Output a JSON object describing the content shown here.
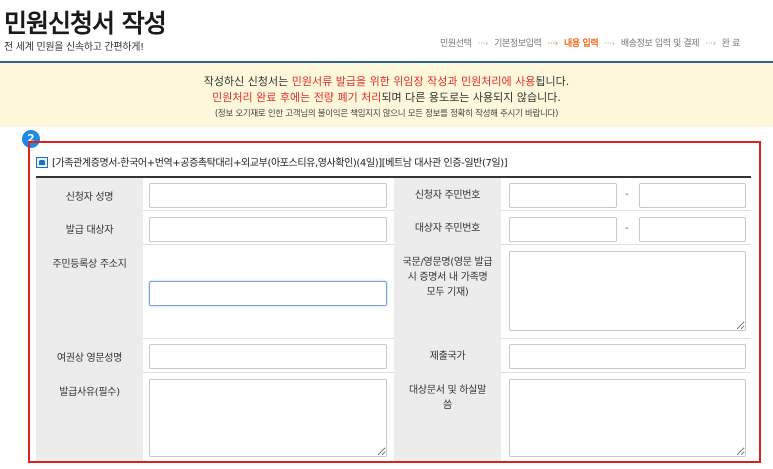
{
  "header": {
    "title": "민원신청서 작성",
    "subtitle": "전 세계 민원을 신속하고 간편하게!"
  },
  "steps": [
    {
      "label": "민원선택",
      "active": false
    },
    {
      "label": "기본정보입력",
      "active": false
    },
    {
      "label": "내용 입력",
      "active": true
    },
    {
      "label": "배송정보 입력 및 결제",
      "active": false
    },
    {
      "label": "완 료",
      "active": false
    }
  ],
  "notice": {
    "line1_a": "작성하신 신청서는 ",
    "line1_b": "민원서류 발급을 위한 위임장 작성과 민원처리에 사용",
    "line1_c": "됩니다.",
    "line2_a": "민원처리 완료 후에는 전량 폐기 처리",
    "line2_b": "되며 다른 용도로는 사용되지 않습니다.",
    "line3": "(정보 오기재로 인한 고객님의 불이익은 책임지지 않으니 모든 정보를 정확히 작성해 주시기 바랍니다)"
  },
  "section": {
    "badge": "2",
    "product_title": "[가족관계증명서-한국어+번역+공증촉탁대리+외교부(아포스티유,영사확인)(4일)][베트남 대사관 인증-일반(7일)]"
  },
  "form": {
    "applicant_name_label": "신청자 성명",
    "applicant_rrn_label": "신청자 주민번호",
    "target_label": "발급 대상자",
    "target_rrn_label": "대상자 주민번호",
    "address_label": "주민등록상 주소지",
    "name_local_label": "국문/영문명(영문 발급 시 증명서 내 가족명 모두 기재)",
    "passport_name_label": "여권상 영문성명",
    "country_label": "제출국가",
    "reason_label": "발급사유(필수)",
    "target_docs_label": "대상문서 및 하실말씀",
    "rrn_separator": "-"
  },
  "colors": {
    "accent_orange": "#f06a1a",
    "notice_red": "#e0312b",
    "highlight_border": "#e01f1f",
    "badge_blue": "#1e88e5",
    "notice_bg": "#fdf8dc"
  }
}
